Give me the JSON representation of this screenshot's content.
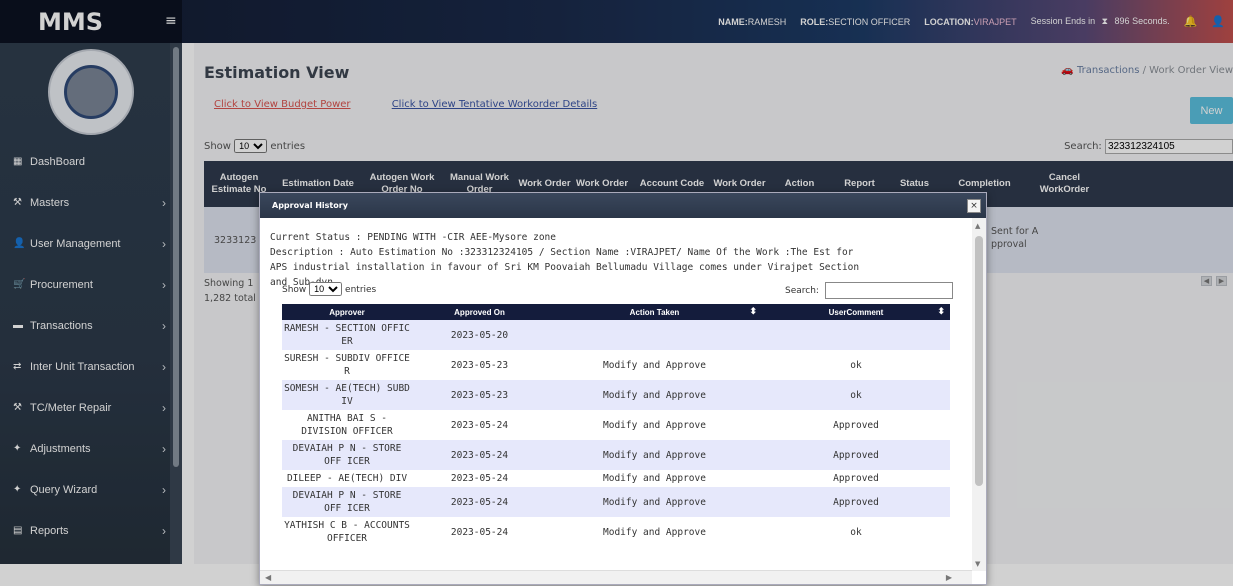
{
  "app": {
    "brand": "MMS",
    "menu_toggle_icon": "hamburger-icon"
  },
  "header": {
    "name_label": "NAME:",
    "name_value": "RAMESH",
    "role_label": "ROLE:",
    "role_value": "SECTION OFFICER",
    "location_label": "LOCATION:",
    "location_value": "VIRAJPET",
    "session_text": "Session Ends in",
    "session_seconds": "896",
    "session_unit": "Seconds."
  },
  "sidebar": {
    "items": [
      {
        "label": "DashBoard",
        "icon": "dashboard-icon",
        "glyph": "▦",
        "has_children": false
      },
      {
        "label": "Masters",
        "icon": "tools-icon",
        "glyph": "⚒",
        "has_children": true
      },
      {
        "label": "User Management",
        "icon": "user-icon",
        "glyph": "👤",
        "has_children": true
      },
      {
        "label": "Procurement",
        "icon": "cart-icon",
        "glyph": "🛒",
        "has_children": true
      },
      {
        "label": "Transactions",
        "icon": "briefcase-icon",
        "glyph": "▬",
        "has_children": true
      },
      {
        "label": "Inter Unit Transaction",
        "icon": "exchange-icon",
        "glyph": "⇄",
        "has_children": true
      },
      {
        "label": "TC/Meter Repair",
        "icon": "wrench-icon",
        "glyph": "⚒",
        "has_children": true
      },
      {
        "label": "Adjustments",
        "icon": "pin-icon",
        "glyph": "✦",
        "has_children": true
      },
      {
        "label": "Query Wizard",
        "icon": "pin-icon",
        "glyph": "✦",
        "has_children": true
      },
      {
        "label": "Reports",
        "icon": "report-icon",
        "glyph": "▤",
        "has_children": true
      }
    ]
  },
  "page": {
    "title": "Estimation View",
    "breadcrumb": {
      "parent": "Transactions",
      "separator": "/",
      "current": "Work Order View"
    },
    "links": {
      "budget": "Click to View Budget Power",
      "tentative": "Click to View Tentative Workorder Details"
    },
    "new_button": "New",
    "show_label": "Show",
    "entries_value": "10",
    "entries_label": "entries",
    "search_label": "Search:",
    "search_value": "323312324105",
    "columns": [
      "Autogen Estimate No",
      "Estimation Date",
      "Autogen Work Order No",
      "Manual Work Order",
      "Work Order",
      "Work Order",
      "Account Code",
      "Work Order",
      "Action",
      "Report",
      "Status",
      "Completion",
      "Cancel WorkOrder"
    ],
    "row": {
      "estimate_no": "3233123",
      "status": "Sent for A pproval"
    },
    "footer_line1": "Showing 1",
    "footer_line2": "1,282 total"
  },
  "modal": {
    "title": "Approval History",
    "close": "×",
    "current_status": "Current Status : PENDING WITH -CIR AEE-Mysore zone",
    "description": "Description : Auto Estimation No :323312324105 / Section Name :VIRAJPET/ Name Of the Work :The Est for APS industrial installation in favour of Sri KM Poovaiah Bellumadu Village comes under Virajpet Section and Sub-dvn",
    "show_label": "Show",
    "entries_value": "10",
    "entries_label": "entries",
    "search_label": "Search:",
    "search_value": "",
    "columns": [
      "Approver",
      "Approved On",
      "Action Taken",
      "UserComment"
    ],
    "rows": [
      {
        "approver": "RAMESH - SECTION OFFIC ER",
        "date": "2023-05-20",
        "action": "",
        "comment": ""
      },
      {
        "approver": "SURESH - SUBDIV OFFICE R",
        "date": "2023-05-23",
        "action": "Modify and Approve",
        "comment": "ok"
      },
      {
        "approver": "SOMESH - AE(TECH) SUBD IV",
        "date": "2023-05-23",
        "action": "Modify and Approve",
        "comment": "ok"
      },
      {
        "approver": "ANITHA BAI S - DIVISION OFFICER",
        "date": "2023-05-24",
        "action": "Modify and Approve",
        "comment": "Approved"
      },
      {
        "approver": "DEVAIAH P N - STORE OFF ICER",
        "date": "2023-05-24",
        "action": "Modify and Approve",
        "comment": "Approved"
      },
      {
        "approver": "DILEEP - AE(TECH) DIV",
        "date": "2023-05-24",
        "action": "Modify and Approve",
        "comment": "Approved"
      },
      {
        "approver": "DEVAIAH P N - STORE OFF ICER",
        "date": "2023-05-24",
        "action": "Modify and Approve",
        "comment": "Approved"
      },
      {
        "approver": "YATHISH C B - ACCOUNTS OFFICER",
        "date": "2023-05-24",
        "action": "Modify and Approve",
        "comment": "ok"
      }
    ]
  }
}
